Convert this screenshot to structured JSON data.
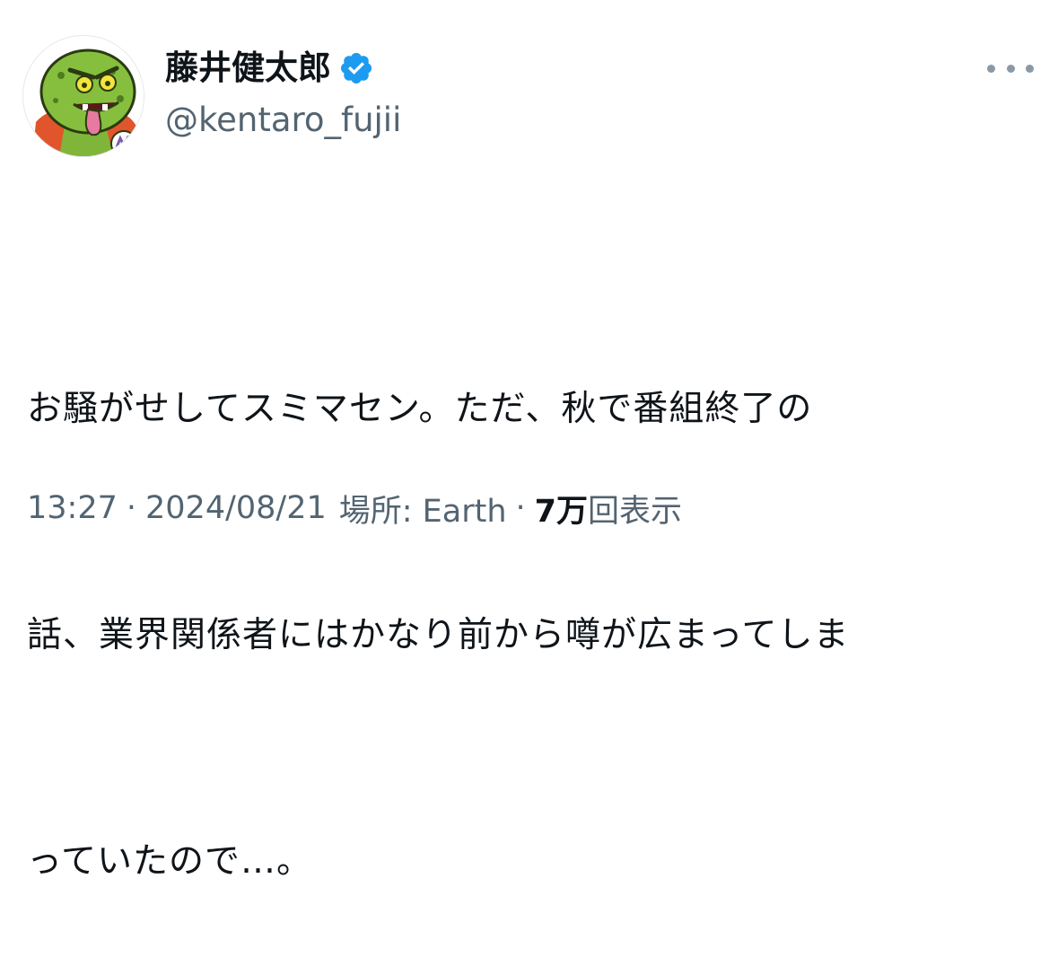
{
  "user": {
    "display_name": "藤井健太郎",
    "handle": "@kentaro_fujii",
    "verified_icon": "verified-badge-icon",
    "avatar_icon": "green-monster-avatar"
  },
  "tweet": {
    "lines": [
      "お騒がせしてスミマセン。ただ、秋で番組終了の",
      "話、業界関係者にはかなり前から噂が広まってしま",
      "っていたので…。"
    ]
  },
  "meta": {
    "time": "13:27",
    "separator": "·",
    "date": "2024/08/21",
    "location": "場所: Earth",
    "views_count": "7万",
    "views_label": "回表示"
  },
  "more_icon": "more-options-icon",
  "colors": {
    "text": "#0f1419",
    "secondary": "#536471",
    "verified_blue": "#1d9bf0",
    "more_dots": "#8b98a5"
  }
}
